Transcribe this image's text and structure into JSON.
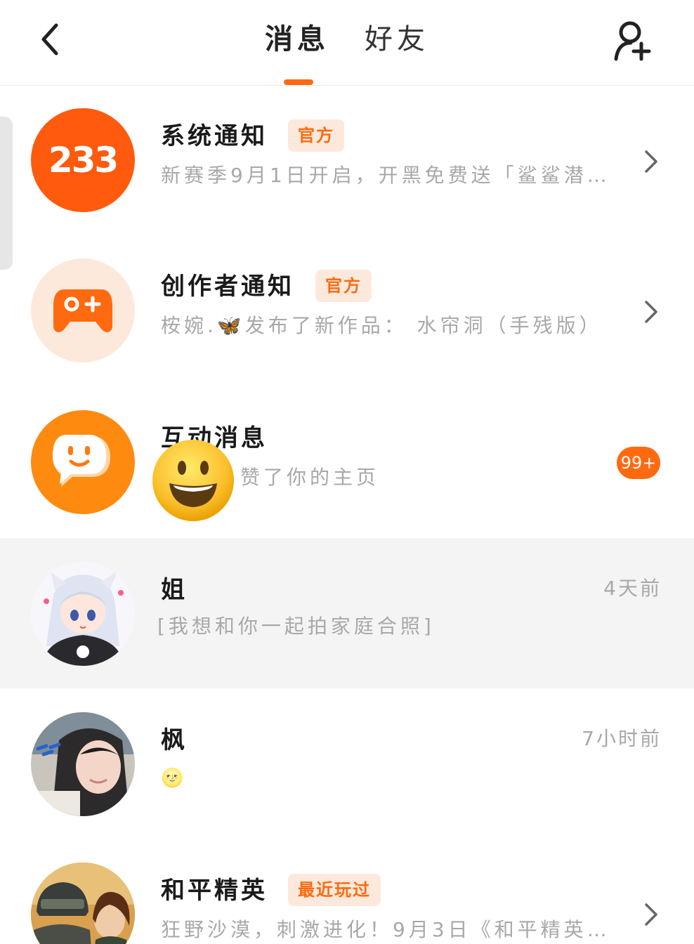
{
  "colors": {
    "accent": "#ff6a10",
    "badge_bg": "#fde9dc",
    "badge_text": "#ff6a10",
    "subtitle": "#a8a8a8",
    "highlight_row": "#f4f4f4"
  },
  "header": {
    "back_icon": "chevron-left-icon",
    "tabs": [
      {
        "label": "消息",
        "active": true
      },
      {
        "label": "好友",
        "active": false
      }
    ],
    "add_friend_icon": "add-user-icon"
  },
  "messages": [
    {
      "title": "系统通知",
      "badge": "官方",
      "avatar_text": "233",
      "subtitle": "新赛季9月1日开启，开黑免费送「鲨鲨潜艇...",
      "chevron": true
    },
    {
      "title": "创作者通知",
      "badge": "官方",
      "avatar_icon": "gamepad-icon",
      "subtitle": "桉婉.🦋发布了新作品： 水帘洞（手残版）",
      "chevron": true
    },
    {
      "title": "互动消息",
      "avatar_icon": "chat-smile-icon",
      "subtitle": "赞了你的主页",
      "unread_count": "99+"
    },
    {
      "title": "姐",
      "time": "4天前",
      "subtitle": "[我想和你一起拍家庭合照]",
      "avatar_icon": "anime-girl-avatar"
    },
    {
      "title": "枫",
      "time": "7小时前",
      "subtitle": "🌝",
      "avatar_icon": "photo-avatar"
    },
    {
      "title": "和平精英",
      "badge": "最近玩过",
      "subtitle": "狂野沙漠，刺激进化！9月3日《和平精英》...",
      "avatar_icon": "game-cover-avatar",
      "chevron": true
    }
  ]
}
